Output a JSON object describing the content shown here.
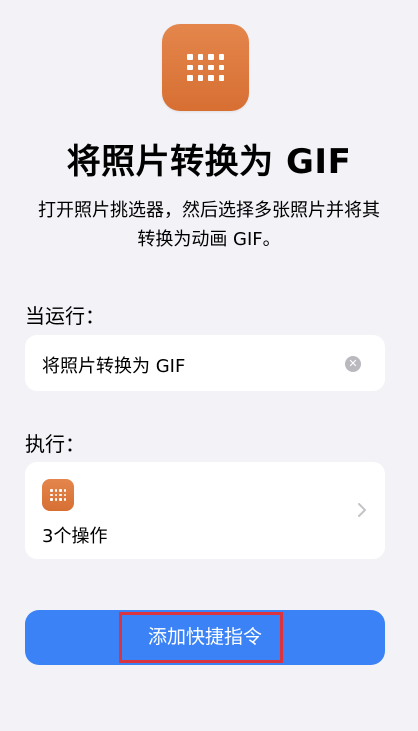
{
  "header": {
    "icon": "grid-icon",
    "title": "将照片转换为 GIF",
    "description": "打开照片挑选器，然后选择多张照片并将其转换为动画 GIF。",
    "accent_color": "#DA7A3E"
  },
  "when_run": {
    "label": "当运行：",
    "field_value": "将照片转换为 GIF",
    "clear_icon": "clear-icon"
  },
  "execute": {
    "label": "执行：",
    "action_icon": "grid-icon",
    "action_count": "3个操作",
    "chevron_icon": "chevron-right-icon"
  },
  "add_button": {
    "label": "添加快捷指令",
    "color": "#3A82F6",
    "highlight_color": "#D9343F"
  }
}
